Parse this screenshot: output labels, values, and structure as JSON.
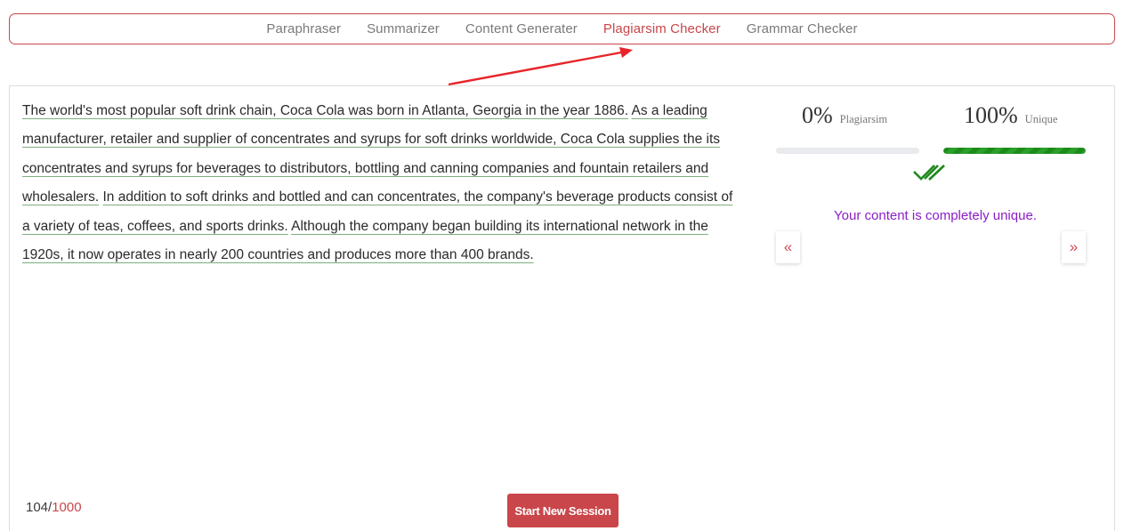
{
  "nav": {
    "tabs": [
      {
        "label": "Paraphraser"
      },
      {
        "label": "Summarizer"
      },
      {
        "label": "Content Generater"
      },
      {
        "label": "Plagiarsim Checker"
      },
      {
        "label": "Grammar Checker"
      }
    ],
    "active_tab": "Plagiarsim Checker",
    "active_color": "#c9464a"
  },
  "editor": {
    "sentences": [
      "The world's most popular soft drink chain, Coca Cola was born in Atlanta, Georgia in the year 1886.",
      "As a leading manufacturer, retailer and supplier of concentrates and syrups for soft drinks worldwide, Coca Cola supplies the its concentrates and syrups for beverages to distributors, bottling and canning companies and fountain retailers and wholesalers.",
      "In addition to soft drinks and bottled and can concentrates, the company's beverage products consist of a variety of teas, coffees, and sports drinks.",
      "Although the company began building its international network in the 1920s, it now operates in nearly 200 countries and produces more than 400 brands."
    ],
    "word_count": "104",
    "word_count_separator": "/",
    "word_limit": "1000",
    "start_button_label": "Start New Session"
  },
  "results": {
    "plagiarism_percent": "0%",
    "plagiarism_label": "Plagiarsim",
    "plagiarism_fraction": 0,
    "unique_percent": "100%",
    "unique_label": "Unique",
    "unique_fraction": 1,
    "status_message": "Your content is completely unique.",
    "status_color": "#8a1ec6",
    "check_icon": "double-check-icon",
    "check_color": "#1e8a1e",
    "prev_icon": "double-chevron-left-icon",
    "next_icon": "double-chevron-right-icon"
  }
}
